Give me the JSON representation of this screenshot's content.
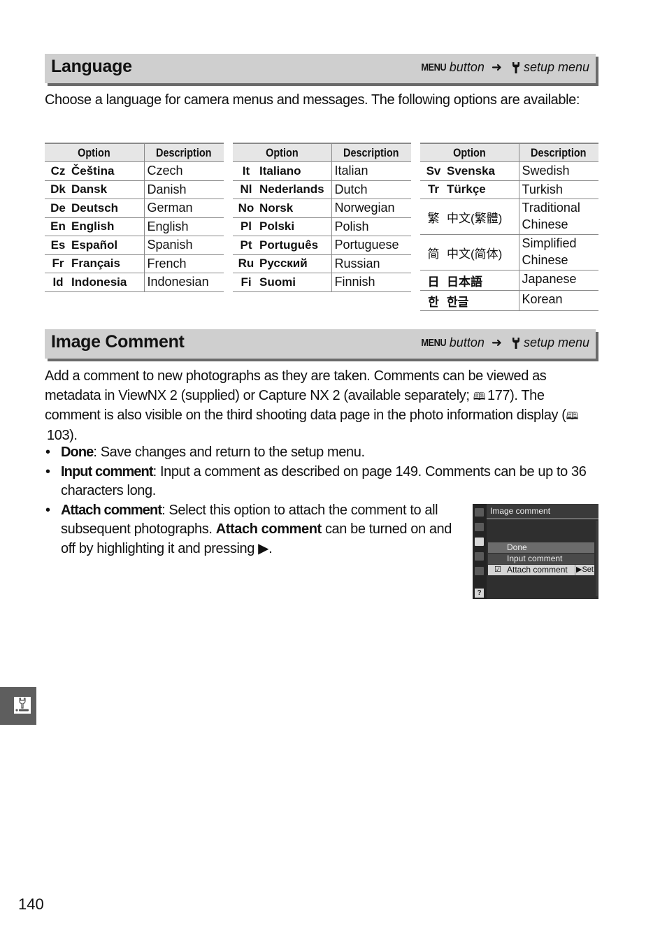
{
  "language_section": {
    "title": "Language",
    "crumb": {
      "menu_label": "MENU",
      "button_text": "button",
      "arrow": "➜",
      "icon": "wrench-icon",
      "menu_text": "setup menu"
    },
    "intro": "Choose a language for camera menus and messages.  The following options are available:",
    "tables": [
      {
        "headers": {
          "option": "Option",
          "description": "Description"
        },
        "rows": [
          {
            "code": "Cz",
            "name": "Čeština",
            "description": "Czech"
          },
          {
            "code": "Dk",
            "name": "Dansk",
            "description": "Danish"
          },
          {
            "code": "De",
            "name": "Deutsch",
            "description": "German"
          },
          {
            "code": "En",
            "name": "English",
            "description": "English"
          },
          {
            "code": "Es",
            "name": "Español",
            "description": "Spanish"
          },
          {
            "code": "Fr",
            "name": "Français",
            "description": "French"
          },
          {
            "code": "Id",
            "name": "Indonesia",
            "description": "Indonesian"
          }
        ]
      },
      {
        "headers": {
          "option": "Option",
          "description": "Description"
        },
        "rows": [
          {
            "code": "It",
            "name": "Italiano",
            "description": "Italian"
          },
          {
            "code": "Nl",
            "name": "Nederlands",
            "description": "Dutch"
          },
          {
            "code": "No",
            "name": "Norsk",
            "description": "Norwegian"
          },
          {
            "code": "Pl",
            "name": "Polski",
            "description": "Polish"
          },
          {
            "code": "Pt",
            "name": "Português",
            "description": "Portuguese"
          },
          {
            "code": "Ru",
            "name": "Русский",
            "description": "Russian"
          },
          {
            "code": "Fi",
            "name": "Suomi",
            "description": "Finnish"
          }
        ]
      },
      {
        "headers": {
          "option": "Option",
          "description": "Description"
        },
        "rows": [
          {
            "code": "Sv",
            "name": "Svenska",
            "description": "Swedish"
          },
          {
            "code": "Tr",
            "name": "Türkçe",
            "description": "Turkish"
          },
          {
            "code": "繁",
            "name": "中文(繁體)",
            "description": "Traditional Chinese"
          },
          {
            "code": "简",
            "name": "中文(简体)",
            "description": "Simplified Chinese"
          },
          {
            "code": "日",
            "name": "日本語",
            "description": "Japanese"
          },
          {
            "code": "한",
            "name": "한글",
            "description": "Korean"
          }
        ]
      }
    ]
  },
  "image_comment_section": {
    "title": "Image Comment",
    "crumb": {
      "menu_label": "MENU",
      "button_text": "button",
      "arrow": "➜",
      "icon": "wrench-icon",
      "menu_text": "setup menu"
    },
    "intro": "Add a comment to new photographs as they are taken.  Comments can be viewed as metadata in ViewNX 2 (supplied) or Capture NX 2 (available separately; 📖 177).  The comment is also visible on the third shooting data page in the photo information display (📖 103).",
    "intro_parts": {
      "p1": "Add a comment to new photographs as they are taken.  Comments can be viewed as metadata in ViewNX 2 (supplied) or Capture NX 2 (available separately; ",
      "ref1": "177",
      "p2": ").  The comment is also visible on the third shooting data page in the photo information display (",
      "ref2": "103",
      "p3": ")."
    },
    "bullets": [
      {
        "term": "Done",
        "text": ": Save changes and return to the setup menu."
      },
      {
        "term": "Input comment",
        "text": ": Input a comment as described on page 149.  Comments can be up to 36 characters long."
      },
      {
        "term": "Attach comment",
        "text_before": ": Select this option to attach the comment to all subsequent photographs.  ",
        "bold_inline": "Attach comment",
        "text_after": " can be turned on and off by highlighting it and pressing ▶."
      }
    ],
    "camera_screen": {
      "title": "Image comment",
      "items": [
        {
          "label": "Done",
          "state": "normal"
        },
        {
          "label": "Input comment",
          "state": "normal"
        },
        {
          "label": "Attach comment",
          "state": "highlighted",
          "checked": true,
          "action": "▶Set"
        }
      ],
      "help_label": "?"
    }
  },
  "side_tab": {
    "icon": "setup-menu-icon"
  },
  "page_number": "140"
}
